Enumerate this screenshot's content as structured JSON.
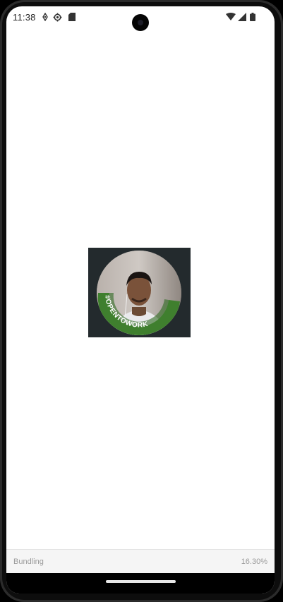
{
  "status_bar": {
    "time": "11:38",
    "left_icons": [
      "location-icon",
      "settings-icon",
      "sd-card-icon"
    ],
    "right_icons": [
      "wifi-icon",
      "cellular-signal-icon",
      "battery-icon"
    ]
  },
  "main": {
    "profile_image": {
      "badge_text": "#OPENTOWORK",
      "badge_color": "#3f7f2e",
      "background_color": "#232a2d"
    }
  },
  "bundle_bar": {
    "label": "Bundling",
    "progress": "16.30%"
  }
}
